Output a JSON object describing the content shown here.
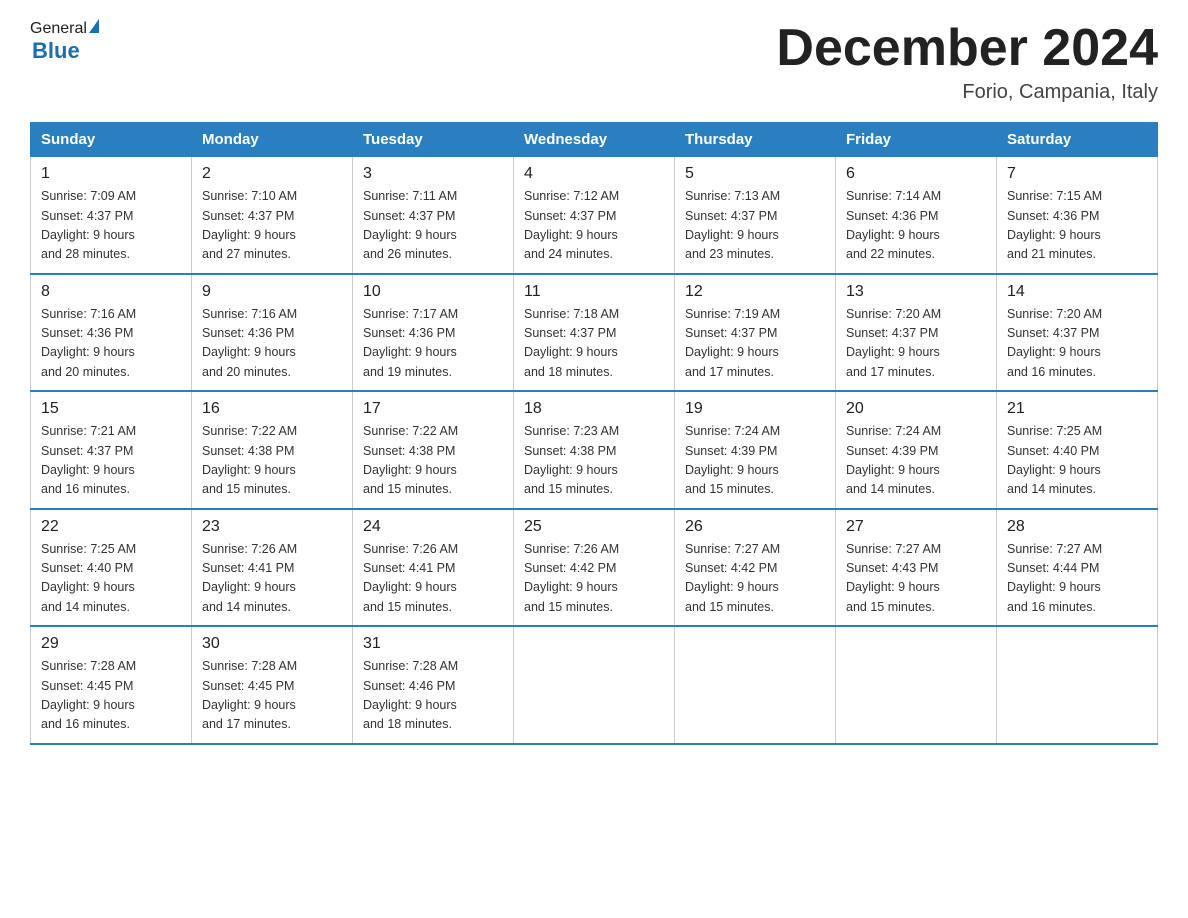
{
  "header": {
    "logo_general": "General",
    "logo_blue": "Blue",
    "month_title": "December 2024",
    "location": "Forio, Campania, Italy"
  },
  "days_of_week": [
    "Sunday",
    "Monday",
    "Tuesday",
    "Wednesday",
    "Thursday",
    "Friday",
    "Saturday"
  ],
  "weeks": [
    [
      {
        "day": "1",
        "sunrise": "7:09 AM",
        "sunset": "4:37 PM",
        "daylight": "9 hours and 28 minutes."
      },
      {
        "day": "2",
        "sunrise": "7:10 AM",
        "sunset": "4:37 PM",
        "daylight": "9 hours and 27 minutes."
      },
      {
        "day": "3",
        "sunrise": "7:11 AM",
        "sunset": "4:37 PM",
        "daylight": "9 hours and 26 minutes."
      },
      {
        "day": "4",
        "sunrise": "7:12 AM",
        "sunset": "4:37 PM",
        "daylight": "9 hours and 24 minutes."
      },
      {
        "day": "5",
        "sunrise": "7:13 AM",
        "sunset": "4:37 PM",
        "daylight": "9 hours and 23 minutes."
      },
      {
        "day": "6",
        "sunrise": "7:14 AM",
        "sunset": "4:36 PM",
        "daylight": "9 hours and 22 minutes."
      },
      {
        "day": "7",
        "sunrise": "7:15 AM",
        "sunset": "4:36 PM",
        "daylight": "9 hours and 21 minutes."
      }
    ],
    [
      {
        "day": "8",
        "sunrise": "7:16 AM",
        "sunset": "4:36 PM",
        "daylight": "9 hours and 20 minutes."
      },
      {
        "day": "9",
        "sunrise": "7:16 AM",
        "sunset": "4:36 PM",
        "daylight": "9 hours and 20 minutes."
      },
      {
        "day": "10",
        "sunrise": "7:17 AM",
        "sunset": "4:36 PM",
        "daylight": "9 hours and 19 minutes."
      },
      {
        "day": "11",
        "sunrise": "7:18 AM",
        "sunset": "4:37 PM",
        "daylight": "9 hours and 18 minutes."
      },
      {
        "day": "12",
        "sunrise": "7:19 AM",
        "sunset": "4:37 PM",
        "daylight": "9 hours and 17 minutes."
      },
      {
        "day": "13",
        "sunrise": "7:20 AM",
        "sunset": "4:37 PM",
        "daylight": "9 hours and 17 minutes."
      },
      {
        "day": "14",
        "sunrise": "7:20 AM",
        "sunset": "4:37 PM",
        "daylight": "9 hours and 16 minutes."
      }
    ],
    [
      {
        "day": "15",
        "sunrise": "7:21 AM",
        "sunset": "4:37 PM",
        "daylight": "9 hours and 16 minutes."
      },
      {
        "day": "16",
        "sunrise": "7:22 AM",
        "sunset": "4:38 PM",
        "daylight": "9 hours and 15 minutes."
      },
      {
        "day": "17",
        "sunrise": "7:22 AM",
        "sunset": "4:38 PM",
        "daylight": "9 hours and 15 minutes."
      },
      {
        "day": "18",
        "sunrise": "7:23 AM",
        "sunset": "4:38 PM",
        "daylight": "9 hours and 15 minutes."
      },
      {
        "day": "19",
        "sunrise": "7:24 AM",
        "sunset": "4:39 PM",
        "daylight": "9 hours and 15 minutes."
      },
      {
        "day": "20",
        "sunrise": "7:24 AM",
        "sunset": "4:39 PM",
        "daylight": "9 hours and 14 minutes."
      },
      {
        "day": "21",
        "sunrise": "7:25 AM",
        "sunset": "4:40 PM",
        "daylight": "9 hours and 14 minutes."
      }
    ],
    [
      {
        "day": "22",
        "sunrise": "7:25 AM",
        "sunset": "4:40 PM",
        "daylight": "9 hours and 14 minutes."
      },
      {
        "day": "23",
        "sunrise": "7:26 AM",
        "sunset": "4:41 PM",
        "daylight": "9 hours and 14 minutes."
      },
      {
        "day": "24",
        "sunrise": "7:26 AM",
        "sunset": "4:41 PM",
        "daylight": "9 hours and 15 minutes."
      },
      {
        "day": "25",
        "sunrise": "7:26 AM",
        "sunset": "4:42 PM",
        "daylight": "9 hours and 15 minutes."
      },
      {
        "day": "26",
        "sunrise": "7:27 AM",
        "sunset": "4:42 PM",
        "daylight": "9 hours and 15 minutes."
      },
      {
        "day": "27",
        "sunrise": "7:27 AM",
        "sunset": "4:43 PM",
        "daylight": "9 hours and 15 minutes."
      },
      {
        "day": "28",
        "sunrise": "7:27 AM",
        "sunset": "4:44 PM",
        "daylight": "9 hours and 16 minutes."
      }
    ],
    [
      {
        "day": "29",
        "sunrise": "7:28 AM",
        "sunset": "4:45 PM",
        "daylight": "9 hours and 16 minutes."
      },
      {
        "day": "30",
        "sunrise": "7:28 AM",
        "sunset": "4:45 PM",
        "daylight": "9 hours and 17 minutes."
      },
      {
        "day": "31",
        "sunrise": "7:28 AM",
        "sunset": "4:46 PM",
        "daylight": "9 hours and 18 minutes."
      },
      null,
      null,
      null,
      null
    ]
  ],
  "labels": {
    "sunrise": "Sunrise:",
    "sunset": "Sunset:",
    "daylight": "Daylight:"
  }
}
